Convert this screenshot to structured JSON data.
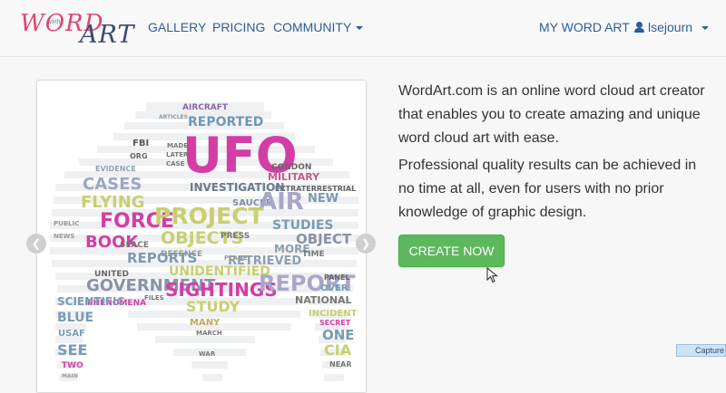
{
  "nav": {
    "logo_word": "WORD",
    "logo_with": "with",
    "logo_art": "ART",
    "gallery": "GALLERY",
    "pricing": "PRICING",
    "community": "COMMUNITY",
    "my_word_art": "MY WORD ART",
    "username": "lsejourn"
  },
  "main": {
    "description_1": "WordArt.com is an online word cloud art creator that enables you to create amazing and unique word cloud art with ease.",
    "description_2": "Professional quality results can be achieved in no time at all, even for users with no prior knowledge of graphic design.",
    "create_button": "CREATE NOW"
  },
  "carousel": {
    "prev_icon": "chevron-left-icon",
    "next_icon": "chevron-right-icon",
    "words": [
      "AIRCRAFT",
      "REPORTED",
      "UFO",
      "ARTICLES",
      "FBI",
      "MADE",
      "LATER",
      "CASE",
      "ORG",
      "EVIDENCE",
      "CONDON",
      "MILITARY",
      "EXTRATERRESTRIAL",
      "CASES",
      "INVESTIGATION",
      "SAUCER",
      "AIR",
      "NEW",
      "FLYING",
      "FORCE",
      "PROJECT",
      "STUDIES",
      "OBJECTS",
      "BOOK",
      "OBJECT",
      "REPORTS",
      "MORE",
      "TIME",
      "RETRIEVED",
      "UNIDENTIFIED",
      "PHENOMENA",
      "UNITED",
      "GOVERNMENT",
      "SIGHTINGS",
      "REPORT",
      "PANEL",
      "OVER",
      "NATIONAL",
      "STUDY",
      "SCIENTIFIC",
      "FILES",
      "INCIDENT",
      "SECRET",
      "BLUE",
      "MANY",
      "ONE",
      "CIA",
      "USAF",
      "SEE",
      "MARCH",
      "WAR",
      "NEAR",
      "TWO",
      "MAIN",
      "PRESS",
      "PLANE",
      "SPACE",
      "DEFENCE",
      "NEWS",
      "PUBLIC"
    ]
  },
  "overlay": {
    "capture": "Capture"
  }
}
